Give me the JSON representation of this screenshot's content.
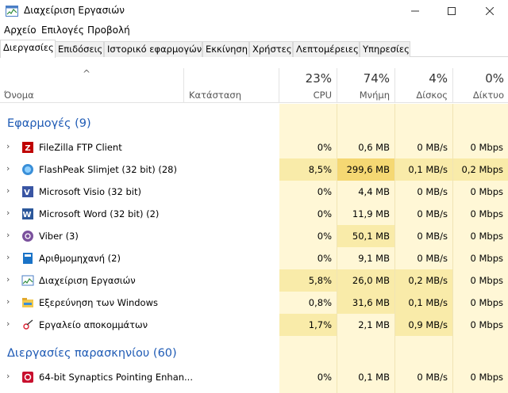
{
  "window": {
    "title": "Διαχείριση Εργασιών"
  },
  "menu": [
    "Αρχείο",
    "Επιλογές",
    "Προβολή"
  ],
  "tabs": [
    "Διεργασίες",
    "Επιδόσεις",
    "Ιστορικό εφαρμογών",
    "Εκκίνηση",
    "Χρήστες",
    "Λεπτομέρειες",
    "Υπηρεσίες"
  ],
  "columns": {
    "name": "Όνομα",
    "status": "Κατάσταση",
    "cpu": {
      "label": "CPU",
      "pct": "23%"
    },
    "mem": {
      "label": "Μνήμη",
      "pct": "74%"
    },
    "disk": {
      "label": "Δίσκος",
      "pct": "4%"
    },
    "net": {
      "label": "Δίκτυο",
      "pct": "0%"
    }
  },
  "groups": {
    "apps": "Εφαρμογές (9)",
    "background": "Διεργασίες παρασκηνίου (60)"
  },
  "rows": [
    {
      "name": "FileZilla FTP Client",
      "cpu": "0%",
      "mem": "0,6 MB",
      "disk": "0 MB/s",
      "net": "0 Mbps",
      "icon": "filezilla-icon"
    },
    {
      "name": "FlashPeak Slimjet (32 bit) (28)",
      "cpu": "8,5%",
      "mem": "299,6 MB",
      "disk": "0,1 MB/s",
      "net": "0,2 Mbps",
      "icon": "slimjet-icon"
    },
    {
      "name": "Microsoft Visio (32 bit)",
      "cpu": "0%",
      "mem": "4,4 MB",
      "disk": "0 MB/s",
      "net": "0 Mbps",
      "icon": "visio-icon"
    },
    {
      "name": "Microsoft Word (32 bit) (2)",
      "cpu": "0%",
      "mem": "11,9 MB",
      "disk": "0 MB/s",
      "net": "0 Mbps",
      "icon": "word-icon"
    },
    {
      "name": "Viber (3)",
      "cpu": "0%",
      "mem": "50,1 MB",
      "disk": "0 MB/s",
      "net": "0 Mbps",
      "icon": "viber-icon"
    },
    {
      "name": "Αριθμομηχανή (2)",
      "cpu": "0%",
      "mem": "9,1 MB",
      "disk": "0 MB/s",
      "net": "0 Mbps",
      "icon": "calculator-icon"
    },
    {
      "name": "Διαχείριση Εργασιών",
      "cpu": "5,8%",
      "mem": "26,0 MB",
      "disk": "0,2 MB/s",
      "net": "0 Mbps",
      "icon": "task-manager-icon"
    },
    {
      "name": "Εξερεύνηση των Windows",
      "cpu": "0,8%",
      "mem": "31,6 MB",
      "disk": "0,1 MB/s",
      "net": "0 Mbps",
      "icon": "explorer-icon"
    },
    {
      "name": "Εργαλείο αποκομμάτων",
      "cpu": "1,7%",
      "mem": "2,1 MB",
      "disk": "0,9 MB/s",
      "net": "0 Mbps",
      "icon": "snipping-tool-icon"
    },
    {
      "name": "64-bit Synaptics Pointing Enhan...",
      "cpu": "0%",
      "mem": "0,1 MB",
      "disk": "0 MB/s",
      "net": "0 Mbps",
      "icon": "synaptics-icon"
    }
  ],
  "colors": {
    "accent": "#1f5bb5",
    "heat_low": "#fff7d6",
    "heat_mid": "#f9eba9",
    "heat_high": "#f5d873"
  }
}
